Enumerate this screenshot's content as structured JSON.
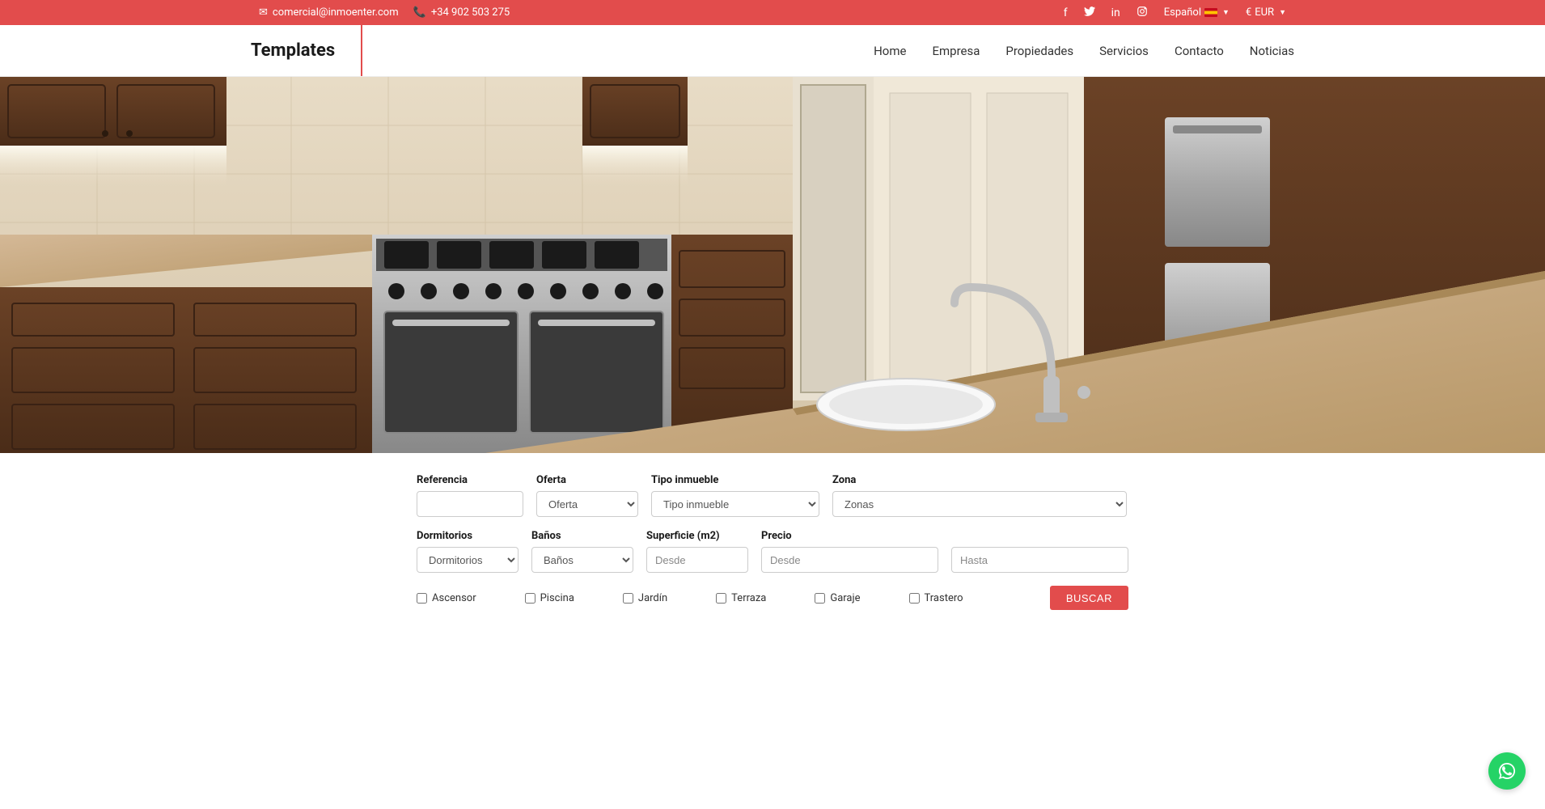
{
  "topbar": {
    "email": "comercial@inmoenter.com",
    "phone": "+34 902 503 275",
    "language": "Español",
    "currency_symbol": "€",
    "currency_code": "EUR"
  },
  "logo": "Templates",
  "nav": {
    "home": "Home",
    "empresa": "Empresa",
    "propiedades": "Propiedades",
    "servicios": "Servicios",
    "contacto": "Contacto",
    "noticias": "Noticias"
  },
  "search": {
    "referencia_label": "Referencia",
    "oferta_label": "Oferta",
    "oferta_selected": "Oferta",
    "tipo_label": "Tipo inmueble",
    "tipo_selected": "Tipo inmueble",
    "zona_label": "Zona",
    "zona_selected": "Zonas",
    "dorm_label": "Dormitorios",
    "dorm_selected": "Dormitorios",
    "banos_label": "Baños",
    "banos_selected": "Baños",
    "superficie_label": "Superficie (m2)",
    "superficie_ph": "Desde",
    "precio_label": "Precio",
    "precio_desde_ph": "Desde",
    "precio_hasta_ph": "Hasta",
    "ascensor": "Ascensor",
    "piscina": "Piscina",
    "jardin": "Jardín",
    "terraza": "Terraza",
    "garaje": "Garaje",
    "trastero": "Trastero",
    "buscar": "BUSCAR"
  }
}
